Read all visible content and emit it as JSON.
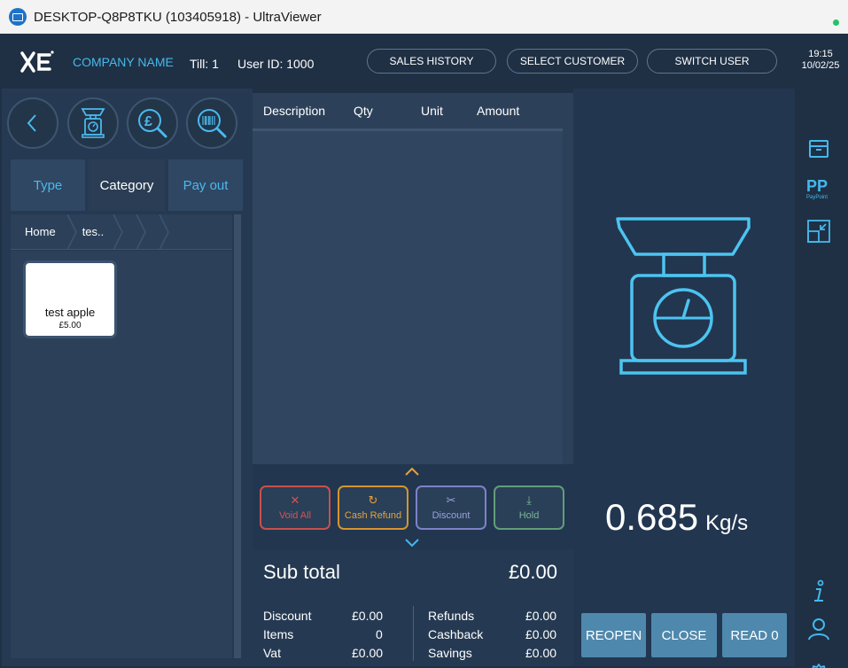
{
  "window": {
    "title": "DESKTOP-Q8P8TKU (103405918) - UltraViewer"
  },
  "header": {
    "logo": "XE",
    "company_name": "COMPANY NAME",
    "till": "Till: 1",
    "user_id": "User ID: 1000",
    "buttons": {
      "sales_history": "SALES HISTORY",
      "select_customer": "SELECT CUSTOMER",
      "switch_user": "SWITCH USER"
    },
    "time": "19:15",
    "date": "10/02/25"
  },
  "left": {
    "round_buttons": [
      "back-icon",
      "scale-icon",
      "price-lookup-icon",
      "barcode-search-icon"
    ],
    "tabs": {
      "type": "Type",
      "category": "Category",
      "pay_out": "Pay out"
    },
    "breadcrumb": {
      "home": "Home",
      "current": "tes.."
    },
    "products": [
      {
        "name": "test apple",
        "price": "£5.00"
      }
    ]
  },
  "order": {
    "columns": {
      "description": "Description",
      "qty": "Qty",
      "unit": "Unit",
      "amount": "Amount"
    },
    "actions": {
      "void_all": "Void All",
      "cash_refund": "Cash Refund",
      "discount": "Discount",
      "hold": "Hold"
    },
    "subtotal_label": "Sub total",
    "subtotal_value": "£0.00",
    "summary_left": [
      {
        "label": "Discount",
        "value": "£0.00"
      },
      {
        "label": "Items",
        "value": "0"
      },
      {
        "label": "Vat",
        "value": "£0.00"
      }
    ],
    "summary_right": [
      {
        "label": "Refunds",
        "value": "£0.00"
      },
      {
        "label": "Cashback",
        "value": "£0.00"
      },
      {
        "label": "Savings",
        "value": "£0.00"
      }
    ]
  },
  "scale": {
    "weight": "0.685",
    "unit": "Kg/s"
  },
  "bottom_buttons": {
    "reopen": "REOPEN",
    "close": "CLOSE",
    "read": "READ 0"
  },
  "sidebar": {
    "paypoint_label": "PayPoint",
    "icons": [
      "drawer-icon",
      "paypoint-icon",
      "resize-icon",
      "info-icon",
      "user-icon",
      "settings-icon"
    ]
  },
  "colors": {
    "accent": "#45b8ec",
    "void": "#d9534f",
    "refund": "#e8a33a",
    "discount": "#8a8fd6",
    "hold": "#6fae85",
    "bottom_button": "#4f88ad"
  }
}
